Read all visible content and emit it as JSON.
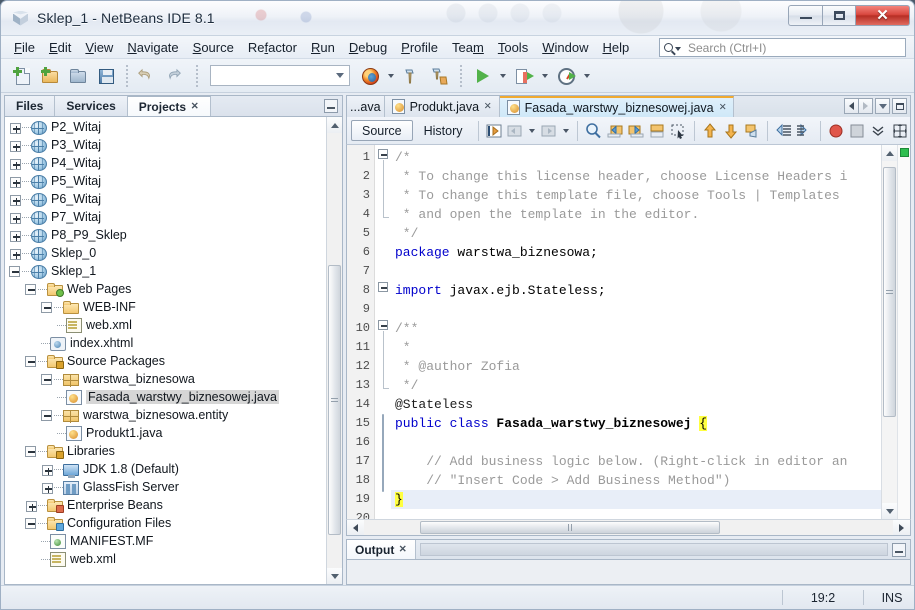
{
  "window": {
    "title": "Sklep_1 - NetBeans IDE 8.1",
    "app_icon": "netbeans-cube-icon",
    "buttons": {
      "minimize": "–",
      "maximize": "▢",
      "close": "✕"
    }
  },
  "menubar": {
    "items": [
      {
        "label": "File",
        "mnemonic": "F"
      },
      {
        "label": "Edit",
        "mnemonic": "E"
      },
      {
        "label": "View",
        "mnemonic": "V"
      },
      {
        "label": "Navigate",
        "mnemonic": "N"
      },
      {
        "label": "Source",
        "mnemonic": "S"
      },
      {
        "label": "Refactor",
        "mnemonic": "f"
      },
      {
        "label": "Run",
        "mnemonic": "R"
      },
      {
        "label": "Debug",
        "mnemonic": "D"
      },
      {
        "label": "Profile",
        "mnemonic": "P"
      },
      {
        "label": "Team",
        "mnemonic": "m"
      },
      {
        "label": "Tools",
        "mnemonic": "T"
      },
      {
        "label": "Window",
        "mnemonic": "W"
      },
      {
        "label": "Help",
        "mnemonic": "H"
      }
    ]
  },
  "search": {
    "placeholder": "Search (Ctrl+I)",
    "value": "",
    "icon": "search-icon"
  },
  "toolbar": {
    "buttons": [
      {
        "name": "new-file-button",
        "icon": "new-file-icon"
      },
      {
        "name": "new-project-button",
        "icon": "new-project-icon"
      },
      {
        "name": "open-project-button",
        "icon": "open-project-icon"
      },
      {
        "name": "save-all-button",
        "icon": "save-all-icon"
      },
      {
        "name": "undo-button",
        "icon": "undo-icon"
      },
      {
        "name": "redo-button",
        "icon": "redo-icon"
      }
    ],
    "config_combo": {
      "value": ""
    },
    "run_buttons": [
      {
        "name": "browser-button",
        "icon": "firefox-icon"
      },
      {
        "name": "build-button",
        "icon": "hammer-icon"
      },
      {
        "name": "clean-build-button",
        "icon": "hammer-broom-icon"
      },
      {
        "name": "run-button",
        "icon": "play-icon"
      },
      {
        "name": "debug-button",
        "icon": "debug-icon"
      },
      {
        "name": "profile-button",
        "icon": "profile-clock-icon"
      }
    ]
  },
  "explorer": {
    "tabs": [
      {
        "label": "Files",
        "active": false,
        "closable": false
      },
      {
        "label": "Services",
        "active": false,
        "closable": false
      },
      {
        "label": "Projects",
        "active": true,
        "closable": true
      }
    ],
    "minimize_label": "minimize",
    "tree": [
      {
        "label": "P2_Witaj",
        "indent": 0,
        "expander": "plus",
        "icon": "project-globe-icon",
        "selected": false
      },
      {
        "label": "P3_Witaj",
        "indent": 0,
        "expander": "plus",
        "icon": "project-globe-icon",
        "selected": false
      },
      {
        "label": "P4_Witaj",
        "indent": 0,
        "expander": "plus",
        "icon": "project-globe-icon",
        "selected": false
      },
      {
        "label": "P5_Witaj",
        "indent": 0,
        "expander": "plus",
        "icon": "project-globe-icon",
        "selected": false
      },
      {
        "label": "P6_Witaj",
        "indent": 0,
        "expander": "plus",
        "icon": "project-globe-icon",
        "selected": false
      },
      {
        "label": "P7_Witaj",
        "indent": 0,
        "expander": "plus",
        "icon": "project-globe-icon",
        "selected": false
      },
      {
        "label": "P8_P9_Sklep",
        "indent": 0,
        "expander": "plus",
        "icon": "project-globe-icon",
        "selected": false
      },
      {
        "label": "Sklep_0",
        "indent": 0,
        "expander": "plus",
        "icon": "project-globe-icon",
        "selected": false
      },
      {
        "label": "Sklep_1",
        "indent": 0,
        "expander": "minus",
        "icon": "project-globe-icon",
        "selected": false
      },
      {
        "label": "Web Pages",
        "indent": 1,
        "expander": "minus",
        "icon": "web-pages-folder-icon",
        "selected": false
      },
      {
        "label": "WEB-INF",
        "indent": 2,
        "expander": "minus",
        "icon": "folder-icon",
        "selected": false
      },
      {
        "label": "web.xml",
        "indent": 3,
        "expander": "leaf",
        "icon": "xml-file-icon",
        "selected": false
      },
      {
        "label": "index.xhtml",
        "indent": 2,
        "expander": "leaf",
        "icon": "xhtml-file-icon",
        "selected": false
      },
      {
        "label": "Source Packages",
        "indent": 1,
        "expander": "minus",
        "icon": "source-packages-icon",
        "selected": false
      },
      {
        "label": "warstwa_biznesowa",
        "indent": 2,
        "expander": "minus",
        "icon": "package-icon",
        "selected": false
      },
      {
        "label": "Fasada_warstwy_biznesowej.java",
        "indent": 3,
        "expander": "leaf",
        "icon": "java-file-icon",
        "selected": true
      },
      {
        "label": "warstwa_biznesowa.entity",
        "indent": 2,
        "expander": "minus",
        "icon": "package-icon",
        "selected": false
      },
      {
        "label": "Produkt1.java",
        "indent": 3,
        "expander": "leaf",
        "icon": "java-file-icon",
        "selected": false
      },
      {
        "label": "Libraries",
        "indent": 1,
        "expander": "minus",
        "icon": "libraries-icon",
        "selected": false
      },
      {
        "label": "JDK 1.8 (Default)",
        "indent": 2,
        "expander": "plus",
        "icon": "jdk-icon",
        "selected": false
      },
      {
        "label": "GlassFish Server",
        "indent": 2,
        "expander": "plus",
        "icon": "server-icon",
        "selected": false
      },
      {
        "label": "Enterprise Beans",
        "indent": 1,
        "expander": "plus",
        "icon": "enterprise-beans-icon",
        "selected": false
      },
      {
        "label": "Configuration Files",
        "indent": 1,
        "expander": "minus",
        "icon": "config-files-icon",
        "selected": false
      },
      {
        "label": "MANIFEST.MF",
        "indent": 2,
        "expander": "leaf",
        "icon": "manifest-file-icon",
        "selected": false
      },
      {
        "label": "web.xml",
        "indent": 2,
        "expander": "leaf",
        "icon": "xml-file-icon",
        "selected": false
      }
    ]
  },
  "editor": {
    "tabs": [
      {
        "label": "...ava",
        "active": false,
        "closable": false,
        "truncated": true
      },
      {
        "label": "Produkt.java",
        "active": false,
        "closable": true,
        "truncated": false
      },
      {
        "label": "Fasada_warstwy_biznesowej.java",
        "active": true,
        "closable": true,
        "truncated": false
      }
    ],
    "tab_controls": [
      {
        "name": "scroll-tabs-left-button",
        "icon": "triangle-left-icon"
      },
      {
        "name": "scroll-tabs-right-button",
        "icon": "triangle-right-icon"
      },
      {
        "name": "tab-list-dropdown-button",
        "icon": "chevron-down-icon"
      },
      {
        "name": "maximize-editor-button",
        "icon": "maximize-icon"
      }
    ],
    "view_tabs": [
      {
        "label": "Source",
        "active": true
      },
      {
        "label": "History",
        "active": false
      }
    ],
    "toolbar_icons": [
      "last-edit-icon",
      "back-icon",
      "forward-icon",
      "find-selection-icon",
      "previous-bookmark-icon",
      "next-bookmark-icon",
      "toggle-bookmark-icon",
      "rectangular-selection-icon",
      "shift-line-up-icon",
      "shift-line-down-icon",
      "comment-icon",
      "shift-left-icon",
      "shift-right-icon",
      "toggle-breakpoint-icon",
      "stop-icon",
      "more-icon",
      "inspect-members-icon"
    ],
    "code": {
      "first_line": 1,
      "current_line": 19,
      "lines": [
        {
          "n": 1,
          "segments": [
            {
              "t": "/*",
              "c": "cmt"
            }
          ]
        },
        {
          "n": 2,
          "segments": [
            {
              "t": " * To change this license header, choose License Headers i",
              "c": "cmt"
            }
          ]
        },
        {
          "n": 3,
          "segments": [
            {
              "t": " * To change this template file, choose Tools | Templates",
              "c": "cmt"
            }
          ]
        },
        {
          "n": 4,
          "segments": [
            {
              "t": " * and open the template in the editor.",
              "c": "cmt"
            }
          ]
        },
        {
          "n": 5,
          "segments": [
            {
              "t": " */",
              "c": "cmt"
            }
          ]
        },
        {
          "n": 6,
          "segments": [
            {
              "t": "package",
              "c": "kw"
            },
            {
              "t": " warstwa_biznesowa;",
              "c": "plain"
            }
          ]
        },
        {
          "n": 7,
          "segments": []
        },
        {
          "n": 8,
          "segments": [
            {
              "t": "import",
              "c": "kw"
            },
            {
              "t": " javax.ejb.Stateless;",
              "c": "plain"
            }
          ]
        },
        {
          "n": 9,
          "segments": []
        },
        {
          "n": 10,
          "segments": [
            {
              "t": "/**",
              "c": "cmt"
            }
          ]
        },
        {
          "n": 11,
          "segments": [
            {
              "t": " *",
              "c": "cmt"
            }
          ]
        },
        {
          "n": 12,
          "segments": [
            {
              "t": " * @author Zofia",
              "c": "cmt"
            }
          ]
        },
        {
          "n": 13,
          "segments": [
            {
              "t": " */",
              "c": "cmt"
            }
          ]
        },
        {
          "n": 14,
          "segments": [
            {
              "t": "@Stateless",
              "c": "anno"
            }
          ]
        },
        {
          "n": 15,
          "segments": [
            {
              "t": "public class ",
              "c": "kw"
            },
            {
              "t": "Fasada_warstwy_biznesowej ",
              "c": "cls"
            },
            {
              "t": "{",
              "c": "hl"
            }
          ]
        },
        {
          "n": 16,
          "segments": []
        },
        {
          "n": 17,
          "segments": [
            {
              "t": "    // Add business logic below. (Right-click in editor an",
              "c": "cmt"
            }
          ]
        },
        {
          "n": 18,
          "segments": [
            {
              "t": "    // \"Insert Code > Add Business Method\")",
              "c": "cmt"
            }
          ]
        },
        {
          "n": 19,
          "segments": [
            {
              "t": "}",
              "c": "hl"
            }
          ]
        },
        {
          "n": 20,
          "segments": []
        }
      ]
    }
  },
  "output": {
    "tab_label": "Output",
    "closable": true,
    "minimize_label": "minimize"
  },
  "statusbar": {
    "cursor_position": "19:2",
    "insert_mode": "INS"
  },
  "colors": {
    "accent_tab": "#cfe8f8",
    "tab_top_orange": "#f0a92f",
    "highlight_yellow": "#ffff40",
    "keyword_blue": "#0000cc",
    "comment_gray": "#9a9a9a",
    "selection_gray": "#d6d6d6",
    "current_line": "#e8eef8",
    "close_red": "#d9483f",
    "error_strip_ok": "#2fbf4f"
  }
}
